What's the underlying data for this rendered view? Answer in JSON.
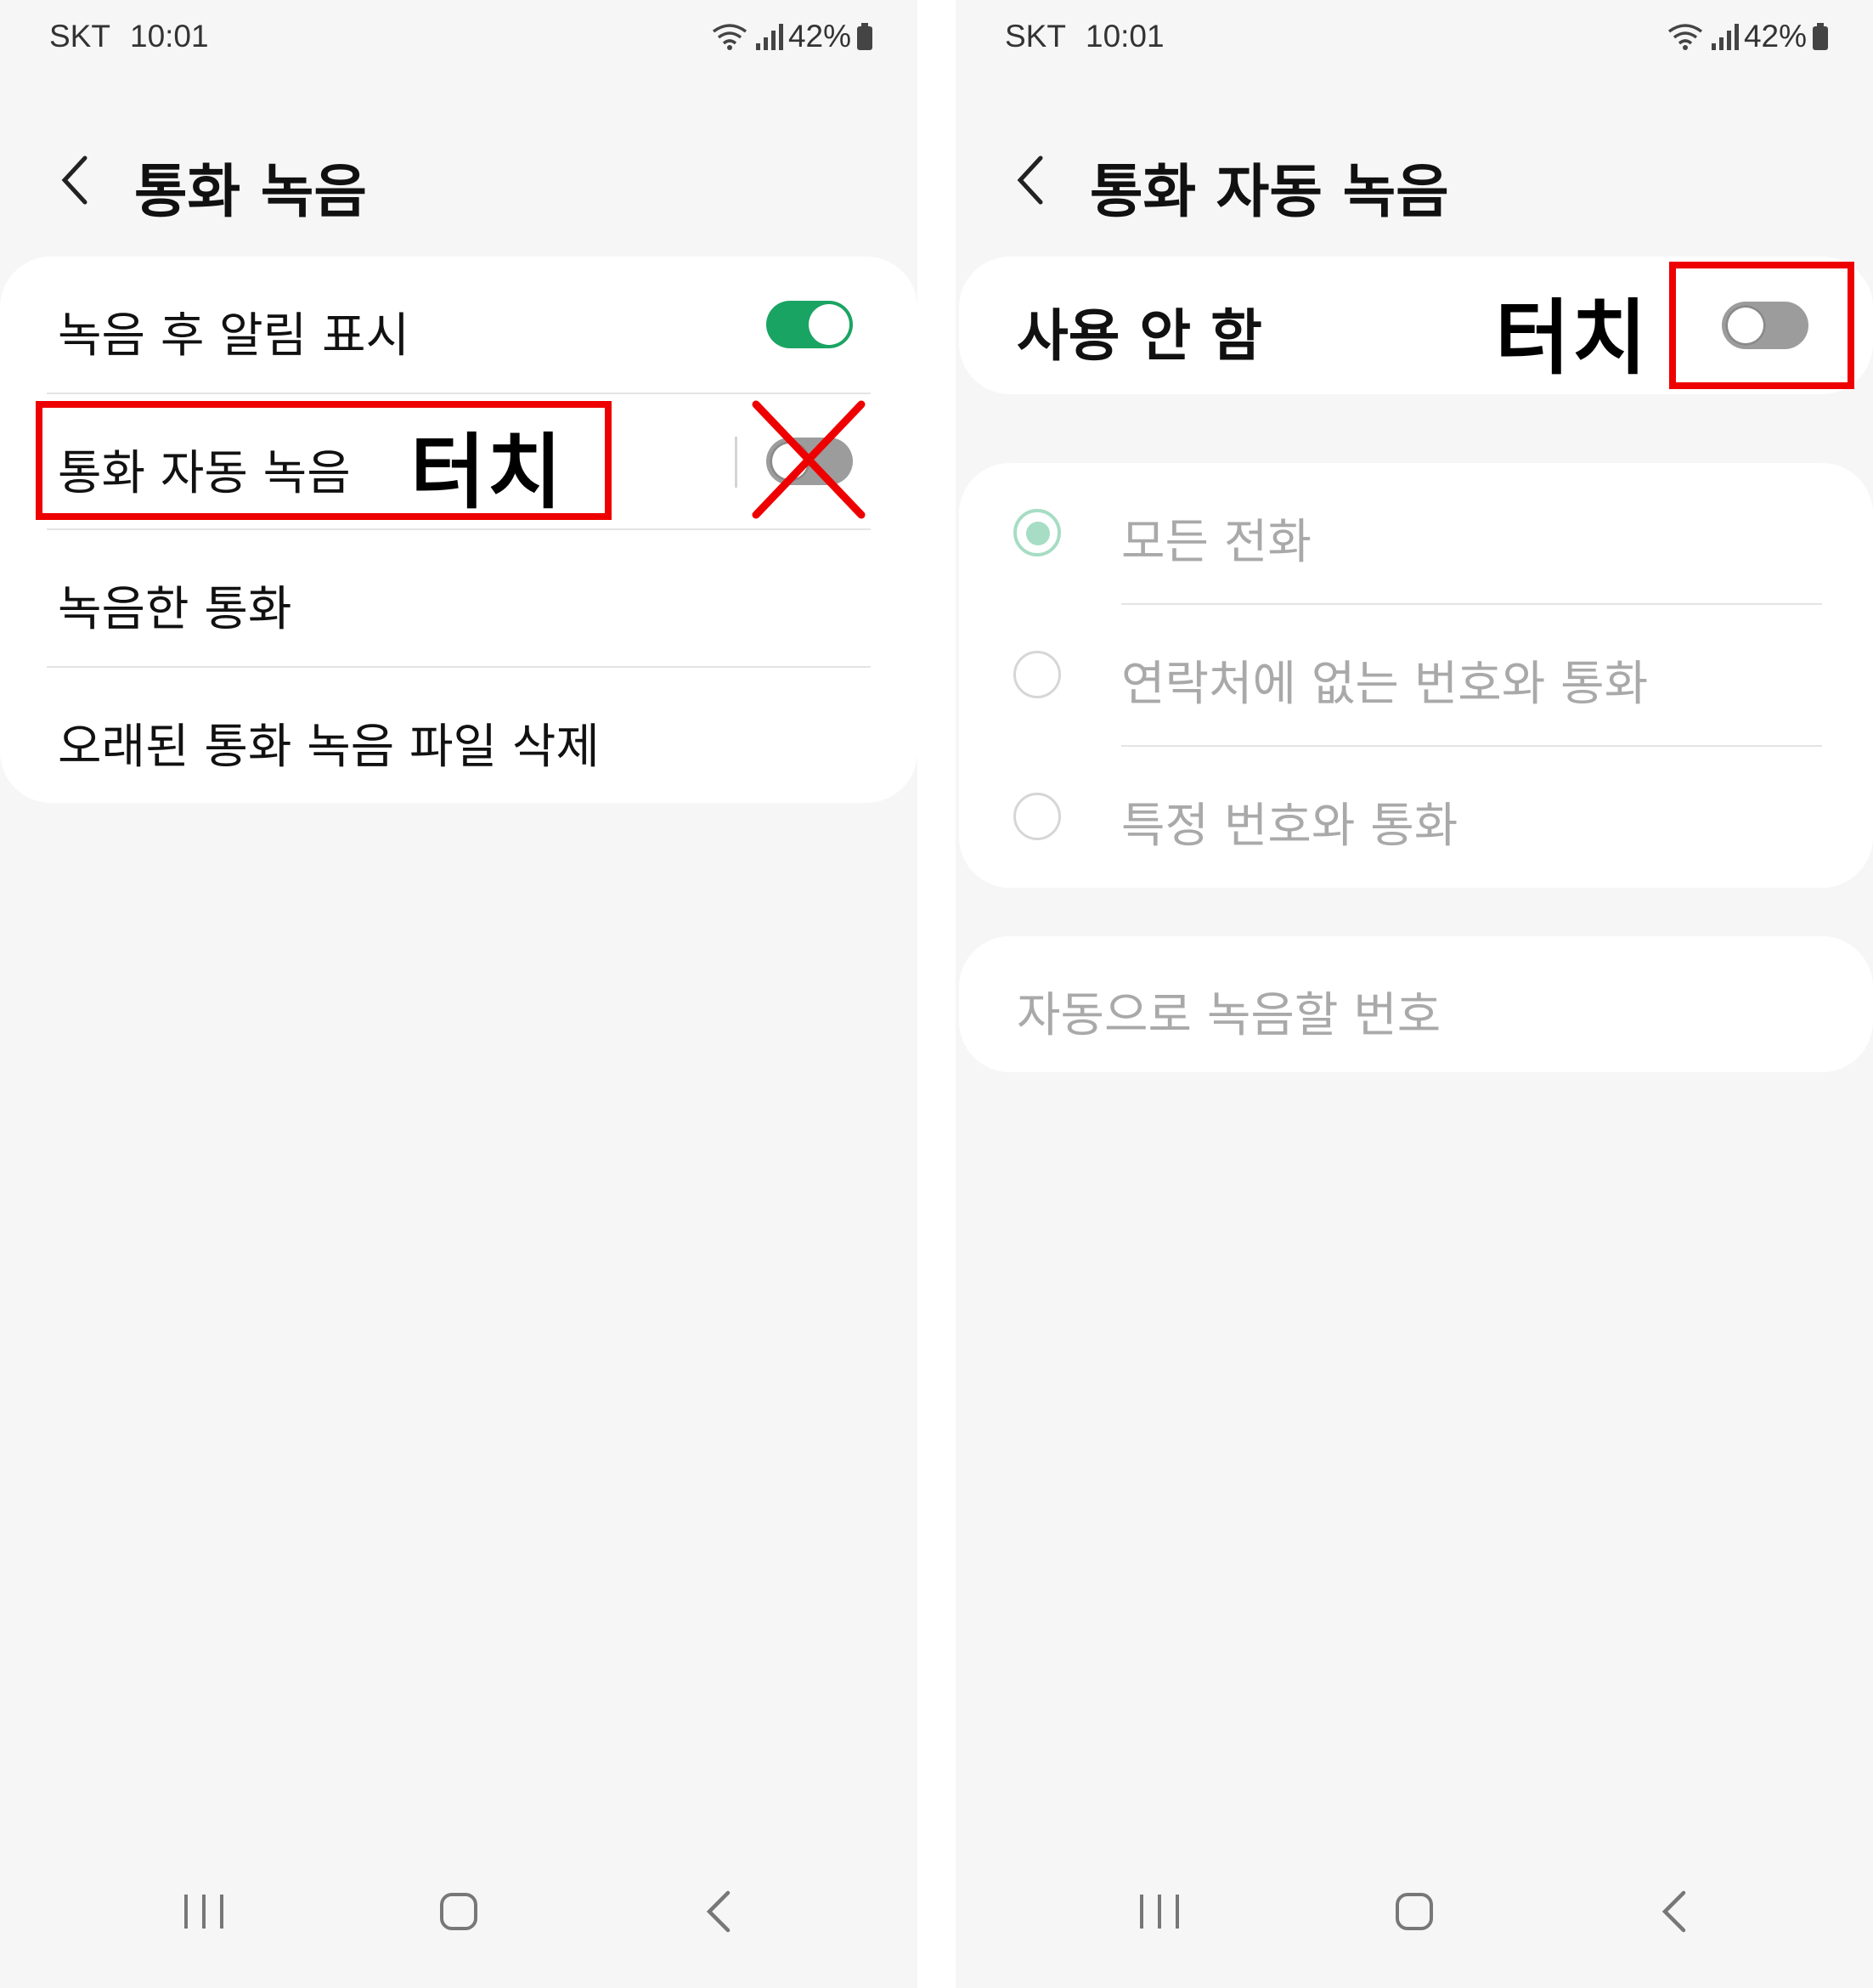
{
  "status_bar": {
    "carrier": "SKT",
    "time": "10:01",
    "battery": "42%"
  },
  "left": {
    "title": "통화 녹음",
    "items": [
      {
        "label": "녹음 후 알림 표시",
        "toggle": "on"
      },
      {
        "label": "통화 자동 녹음",
        "toggle": "off"
      },
      {
        "label": "녹음한 통화"
      },
      {
        "label": "오래된 통화 녹음 파일 삭제"
      }
    ],
    "annotation": "터치"
  },
  "right": {
    "title": "통화 자동 녹음",
    "main_switch": {
      "label": "사용 안 함",
      "toggle": "off"
    },
    "annotation": "터치",
    "options": [
      {
        "label": "모든 전화",
        "selected": true
      },
      {
        "label": "연락처에 없는 번호와 통화",
        "selected": false
      },
      {
        "label": "특정 번호와 통화",
        "selected": false
      }
    ],
    "numbers_item": {
      "label": "자동으로 녹음할 번호"
    }
  },
  "colors": {
    "accent": "#1aa463",
    "annotation_red": "#ee0000",
    "disabled_text": "#a9a9a9"
  },
  "icons": {
    "nav": [
      "recent-apps-icon",
      "home-icon",
      "back-icon"
    ]
  }
}
